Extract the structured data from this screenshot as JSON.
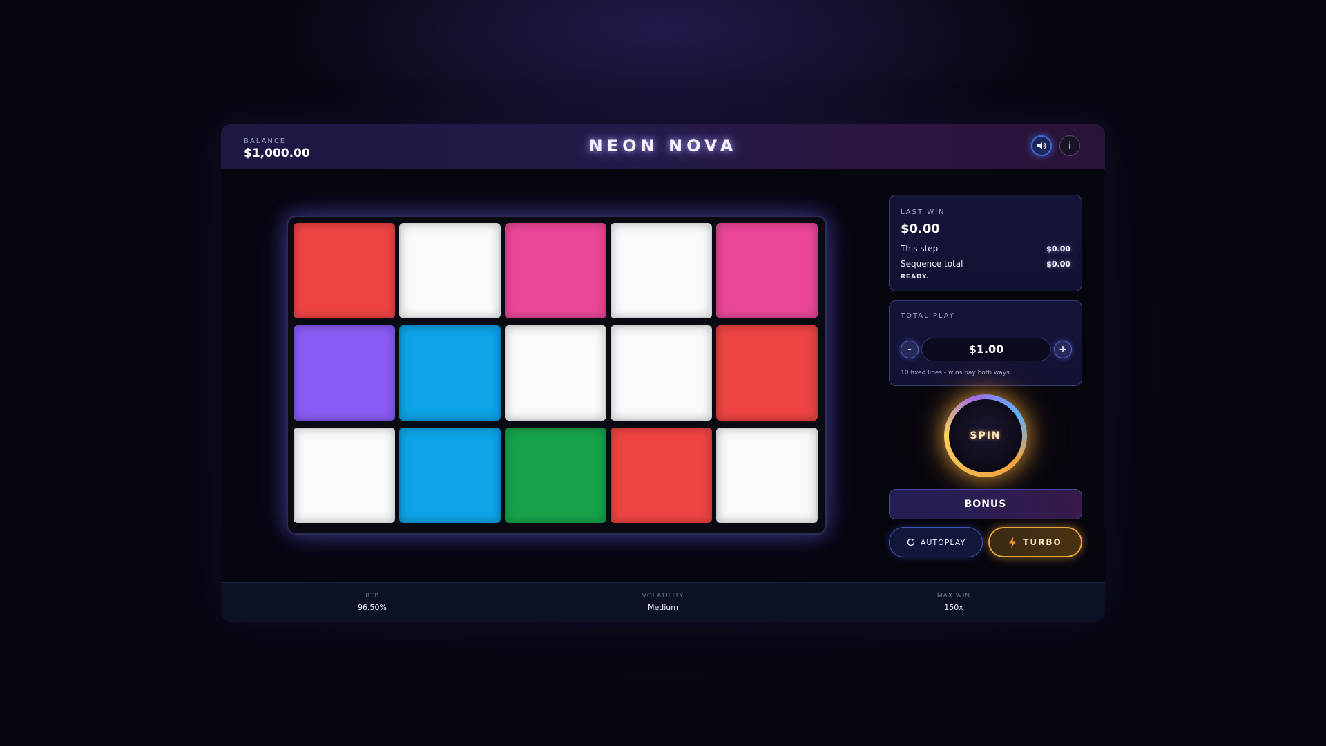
{
  "header": {
    "balance_label": "BALANCE",
    "balance_value": "$1,000.00",
    "title": "NEON NOVA",
    "info_label": "i"
  },
  "icons": {
    "sound": "speaker-icon",
    "info": "info-icon",
    "autoplay": "refresh-icon",
    "turbo": "lightning-icon"
  },
  "grid": {
    "columns": 5,
    "rows": 3,
    "tiles": [
      "#ef4444",
      "#f8fafc",
      "#ec4899",
      "#f8fafc",
      "#ec4899",
      "#8b5cf6",
      "#0ea5e9",
      "#f8fafc",
      "#f8fafc",
      "#ef4444",
      "#f8fafc",
      "#0ea5e9",
      "#16a34a",
      "#ef4444",
      "#f8fafc"
    ]
  },
  "last_win": {
    "label": "LAST WIN",
    "value": "$0.00",
    "this_step_label": "This step",
    "this_step_value": "$0.00",
    "sequence_label": "Sequence total",
    "sequence_value": "$0.00",
    "status": "READY."
  },
  "total_play": {
    "label": "TOTAL PLAY",
    "decrease_label": "-",
    "value": "$1.00",
    "increase_label": "+",
    "note": "10 fixed lines - wins pay both ways."
  },
  "controls": {
    "spin_label": "SPIN",
    "bonus_label": "BONUS",
    "autoplay_label": "AUTOPLAY",
    "turbo_label": "TURBO"
  },
  "footer": {
    "stats": [
      {
        "label": "RTP",
        "value": "96.50%"
      },
      {
        "label": "VOLATILITY",
        "value": "Medium"
      },
      {
        "label": "MAX WIN",
        "value": "150x"
      }
    ]
  }
}
